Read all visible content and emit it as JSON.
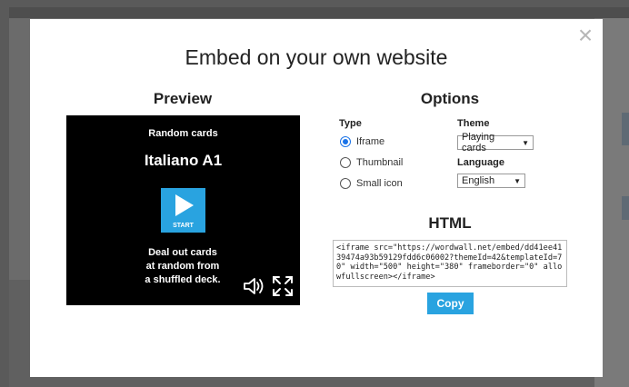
{
  "modal": {
    "title": "Embed on your own website",
    "close_glyph": "×"
  },
  "preview": {
    "heading": "Preview",
    "subtitle": "Random cards",
    "activity_title": "Italiano A1",
    "start_label": "START",
    "description_lines": [
      "Deal out cards",
      "at random from",
      "a shuffled deck."
    ]
  },
  "options": {
    "heading": "Options",
    "type_label": "Type",
    "type_options": [
      {
        "label": "Iframe",
        "selected": true
      },
      {
        "label": "Thumbnail",
        "selected": false
      },
      {
        "label": "Small icon",
        "selected": false
      }
    ],
    "theme_label": "Theme",
    "theme_value": "Playing cards",
    "language_label": "Language",
    "language_value": "English"
  },
  "html_section": {
    "heading": "HTML",
    "code": "<iframe src=\"https://wordwall.net/embed/dd41ee4139474a93b59129fdd6c06002?themeId=42&templateId=70\" width=\"500\" height=\"380\" frameborder=\"0\" allowfullscreen></iframe>",
    "copy_label": "Copy"
  },
  "colors": {
    "accent": "#29a3e0",
    "radio_selected": "#1a73e8"
  },
  "icons": {
    "close": "close-icon",
    "play": "play-icon",
    "volume": "volume-icon",
    "fullscreen": "fullscreen-icon"
  }
}
